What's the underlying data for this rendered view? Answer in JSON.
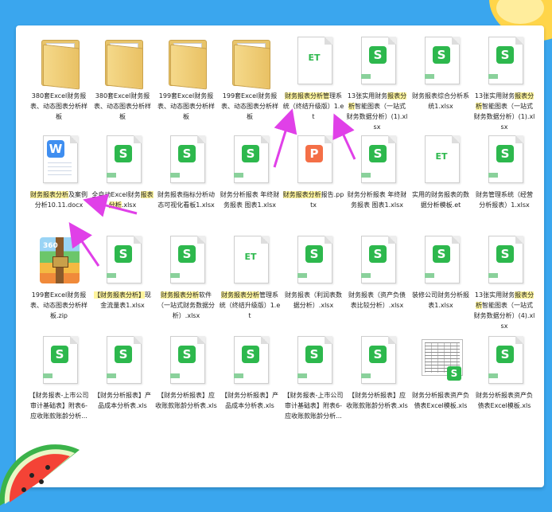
{
  "colors": {
    "highlight": "#fff59d",
    "arrow": "#e040e8",
    "sheet_green": "#2db84d"
  },
  "items": [
    {
      "type": "folder",
      "label": "380套Excel财务报表、动态图表分析样板",
      "hl": ""
    },
    {
      "type": "folder",
      "label": "380套Excel财务报表、动态图表分析样板",
      "hl": ""
    },
    {
      "type": "folder",
      "label": "199套Excel财务报表、动态图表分析样板",
      "hl": ""
    },
    {
      "type": "folder",
      "label": "199套Excel财务报表、动态图表分析样板",
      "hl": ""
    },
    {
      "type": "et",
      "label": "财务报表分析管理系统（终结升级版）1.et",
      "hl": "财务报表分析管"
    },
    {
      "type": "s",
      "label": "13张实用财务报表分析智能图表（一站式财务数据分析）(1).xlsx",
      "hl": "报表分析"
    },
    {
      "type": "s",
      "label": "财务报表综合分析系统1.xlsx",
      "hl": ""
    },
    {
      "type": "s",
      "label": "13张实用财务报表分析智能图表（一站式财务数据分析）(1).xlsx",
      "hl": "报表分析"
    },
    {
      "type": "wps",
      "label": "财务报表分析及案例分析10.11.docx",
      "hl": "财务报表分析"
    },
    {
      "type": "s",
      "label": "全自动Excel财务报表分析.xlsx",
      "hl": "报表分析"
    },
    {
      "type": "s",
      "label": "财务报表指标分析动态可视化看板1.xlsx",
      "hl": ""
    },
    {
      "type": "s",
      "label": "财务分析报表 年终财务报表 图表1.xlsx",
      "hl": ""
    },
    {
      "type": "ppt",
      "label": "财务报表分析报告.pptx",
      "hl": "财务报表分析"
    },
    {
      "type": "s",
      "label": "财务分析报表 年终财务报表 图表1.xlsx",
      "hl": ""
    },
    {
      "type": "et",
      "label": "实用的财务报表的数据分析模板.et",
      "hl": ""
    },
    {
      "type": "s",
      "label": "财务管理系统（经营分析报表）1.xlsx",
      "hl": ""
    },
    {
      "type": "zip",
      "label": "199套Excel财务报表、动态图表分析样板.zip",
      "hl": ""
    },
    {
      "type": "s",
      "label": "【财务报表分析】现金流量表1.xlsx",
      "hl": "【财务报表分析】"
    },
    {
      "type": "s",
      "label": "财务报表分析软件（一站式财务数据分析）.xlsx",
      "hl": "财务报表分析"
    },
    {
      "type": "et",
      "label": "财务报表分析管理系统（终结升级版）1.et",
      "hl": "财务报表分析"
    },
    {
      "type": "s",
      "label": "财务报表（利润表数据分析）.xlsx",
      "hl": ""
    },
    {
      "type": "s",
      "label": "财务报表（资产负债表比较分析）.xlsx",
      "hl": ""
    },
    {
      "type": "s",
      "label": "装修公司财务分析报表1.xlsx",
      "hl": ""
    },
    {
      "type": "s",
      "label": "13张实用财务报表分析智能图表（一站式财务数据分析）(4).xlsx",
      "hl": "报表分析"
    },
    {
      "type": "s",
      "label": "【财务报表-上市公司审计基础表】附表6-应收账款账龄分析...",
      "hl": ""
    },
    {
      "type": "s",
      "label": "【财务分析报表】产品成本分析表.xls",
      "hl": ""
    },
    {
      "type": "s",
      "label": "【财务分析报表】应收账款账龄分析表.xls",
      "hl": ""
    },
    {
      "type": "s",
      "label": "【财务分析报表】产品成本分析表.xls",
      "hl": ""
    },
    {
      "type": "s",
      "label": "【财务报表-上市公司审计基础表】附表6-应收账款账龄分析...",
      "hl": ""
    },
    {
      "type": "s",
      "label": "【财务分析报表】应收账款账龄分析表.xls",
      "hl": ""
    },
    {
      "type": "thumb",
      "label": "财务分析报表资产负债表Excel模板.xls",
      "hl": ""
    },
    {
      "type": "s",
      "label": "财务分析报表资产负债表Excel模板.xls",
      "hl": ""
    }
  ]
}
